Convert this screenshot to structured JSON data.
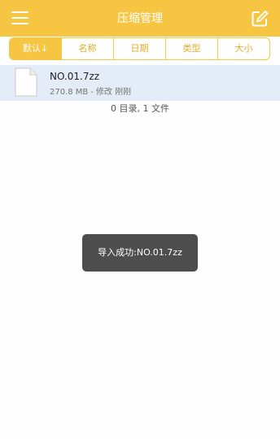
{
  "header": {
    "title": "压缩管理",
    "menu_icon": "hamburger-menu-icon",
    "edit_icon": "edit-square-icon"
  },
  "sort_tabs": [
    {
      "label": "默认↓",
      "selected": true
    },
    {
      "label": "名称",
      "selected": false
    },
    {
      "label": "日期",
      "selected": false
    },
    {
      "label": "类型",
      "selected": false
    },
    {
      "label": "大小",
      "selected": false
    }
  ],
  "file": {
    "icon": "file-icon",
    "name": "NO.01.7zz",
    "size": "270.8 MB",
    "modified_label": "修改",
    "modified_time": "刚刚"
  },
  "summary": "0 目录, 1 文件",
  "toast": "导入成功:NO.01.7zz",
  "colors": {
    "accent": "#f6c643",
    "selected_row": "#e4ecf8",
    "toast_bg": "#4e4e4e"
  }
}
